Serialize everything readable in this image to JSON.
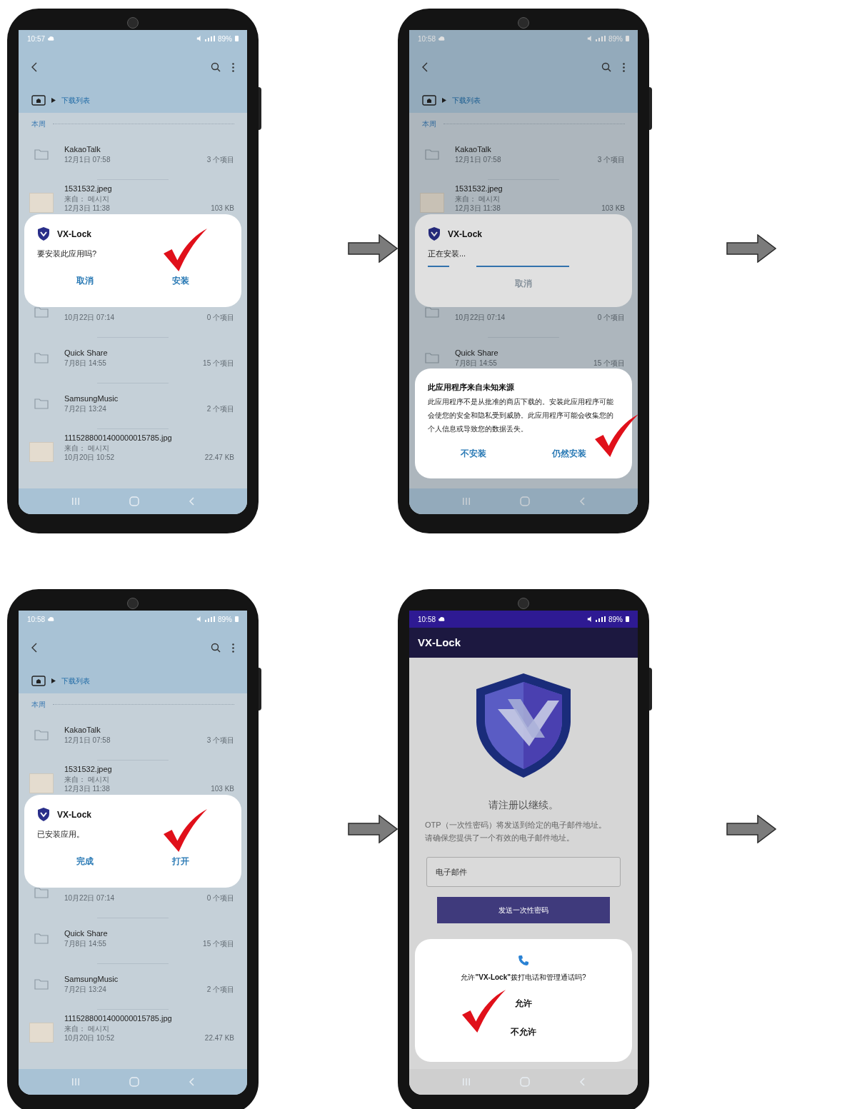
{
  "steps": [
    {
      "kind": "files",
      "status": {
        "time": "10:57",
        "battery": "89%"
      },
      "breadcrumb": "下载列表",
      "section": "本周",
      "rows": [
        {
          "kind": "folder",
          "name": "KakaoTalk",
          "date": "12月1日 07:58",
          "size": "3 个项目"
        },
        {
          "kind": "image",
          "name": "1531532.jpeg",
          "source": "来自： 메시지",
          "date": "12月3日 11:38",
          "size": "103 KB"
        },
        {
          "kind": "folder",
          "date": "10月22日 07:14",
          "size": "0 个项目"
        },
        {
          "kind": "folder",
          "name": "Quick Share",
          "date": "7月8日 14:55",
          "size": "15 个项目"
        },
        {
          "kind": "folder",
          "name": "SamsungMusic",
          "date": "7月2日 13:24",
          "size": "2 个项目"
        },
        {
          "kind": "image",
          "name": "1115288001400000015785.jpg",
          "source": "来自： 메시지",
          "date": "10月20日 10:52",
          "size": "22.47 KB"
        }
      ],
      "dialogs": [
        {
          "kind": "app",
          "app": "VX-Lock",
          "message": "要安装此应用吗?",
          "buttons": [
            {
              "label": "取消",
              "marked": false
            },
            {
              "label": "安装",
              "marked": true
            }
          ]
        }
      ]
    },
    {
      "kind": "files",
      "status": {
        "time": "10:58",
        "battery": "89%"
      },
      "breadcrumb": "下载列表",
      "section": "本周",
      "rows": [
        {
          "kind": "folder",
          "name": "KakaoTalk",
          "date": "12月1日 07:58",
          "size": "3 个项目"
        },
        {
          "kind": "image",
          "name": "1531532.jpeg",
          "source": "来自： 메시지",
          "date": "12月3日 11:38",
          "size": "103 KB"
        },
        {
          "kind": "folder",
          "date": "10月22日 07:14",
          "size": "0 个项目"
        },
        {
          "kind": "folder",
          "name": "Quick Share",
          "date": "7月8日 14:55",
          "size": "15 个项目"
        }
      ],
      "dialogs": [
        {
          "kind": "progress",
          "app": "VX-Lock",
          "message": "正在安装...",
          "buttons": [
            {
              "label": "取消",
              "disabled": true
            }
          ]
        },
        {
          "kind": "warning",
          "title": "此应用程序来自未知来源",
          "message": "此应用程序不是从批准的商店下载的。安装此应用程序可能会使您的安全和隐私受到威胁。此应用程序可能会收集您的个人信息或导致您的数据丢失。",
          "buttons": [
            {
              "label": "不安装",
              "marked": false
            },
            {
              "label": "仍然安装",
              "marked": true
            }
          ]
        }
      ]
    },
    {
      "kind": "files",
      "status": {
        "time": "10:58",
        "battery": "89%"
      },
      "breadcrumb": "下载列表",
      "section": "本周",
      "rows": [
        {
          "kind": "folder",
          "name": "KakaoTalk",
          "date": "12月1日 07:58",
          "size": "3 个项目"
        },
        {
          "kind": "image",
          "name": "1531532.jpeg",
          "source": "来自： 메시지",
          "date": "12月3日 11:38",
          "size": "103 KB"
        },
        {
          "kind": "folder",
          "date": "10月22日 07:14",
          "size": "0 个项目"
        },
        {
          "kind": "folder",
          "name": "Quick Share",
          "date": "7月8日 14:55",
          "size": "15 个项目"
        },
        {
          "kind": "folder",
          "name": "SamsungMusic",
          "date": "7月2日 13:24",
          "size": "2 个项目"
        },
        {
          "kind": "image",
          "name": "1115288001400000015785.jpg",
          "source": "来自： 메시지",
          "date": "10月20日 10:52",
          "size": "22.47 KB"
        }
      ],
      "dialogs": [
        {
          "kind": "app",
          "app": "VX-Lock",
          "message": "已安装应用。",
          "buttons": [
            {
              "label": "完成",
              "marked": false
            },
            {
              "label": "打开",
              "marked": true
            }
          ]
        }
      ]
    },
    {
      "kind": "app",
      "status": {
        "time": "10:58",
        "battery": "89%"
      },
      "title": "VX-Lock",
      "heading": "请注册以继续。",
      "lines": [
        "OTP（一次性密码）将发送到给定的电子邮件地址。",
        "请确保您提供了一个有效的电子邮件地址。"
      ],
      "email": {
        "placeholder": "电子邮件"
      },
      "submit": "发送一次性密码",
      "dialogs": [
        {
          "kind": "permission",
          "message": "允许**\"VX-Lock\"**拨打电话和管理通话吗?",
          "buttons": [
            {
              "label": "允许",
              "marked": true
            },
            {
              "label": "不允许",
              "marked": false
            }
          ]
        }
      ]
    }
  ]
}
